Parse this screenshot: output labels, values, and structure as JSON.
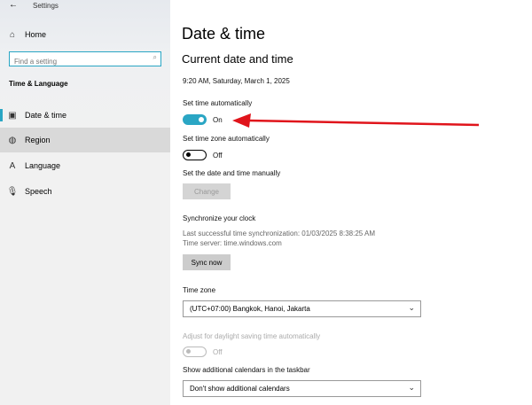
{
  "window": {
    "title": "Settings"
  },
  "sidebar": {
    "home": "Home",
    "search_placeholder": "Find a setting",
    "section": "Time & Language",
    "items": [
      {
        "label": "Date & time"
      },
      {
        "label": "Region"
      },
      {
        "label": "Language"
      },
      {
        "label": "Speech"
      }
    ]
  },
  "main": {
    "title": "Date & time",
    "subtitle": "Current date and time",
    "current": "9:20 AM, Saturday, March 1, 2025",
    "set_time_auto": {
      "label": "Set time automatically",
      "state": "On"
    },
    "set_tz_auto": {
      "label": "Set time zone automatically",
      "state": "Off"
    },
    "manual": {
      "label": "Set the date and time manually",
      "button": "Change"
    },
    "sync": {
      "label": "Synchronize your clock",
      "last": "Last successful time synchronization: 01/03/2025 8:38:25 AM",
      "server": "Time server: time.windows.com",
      "button": "Sync now"
    },
    "timezone": {
      "label": "Time zone",
      "value": "(UTC+07:00) Bangkok, Hanoi, Jakarta"
    },
    "dst": {
      "label": "Adjust for daylight saving time automatically",
      "state": "Off"
    },
    "calendars": {
      "label": "Show additional calendars in the taskbar",
      "value": "Don't show additional calendars"
    }
  },
  "colors": {
    "accent": "#2aa6c4",
    "arrow": "#e0141b"
  }
}
